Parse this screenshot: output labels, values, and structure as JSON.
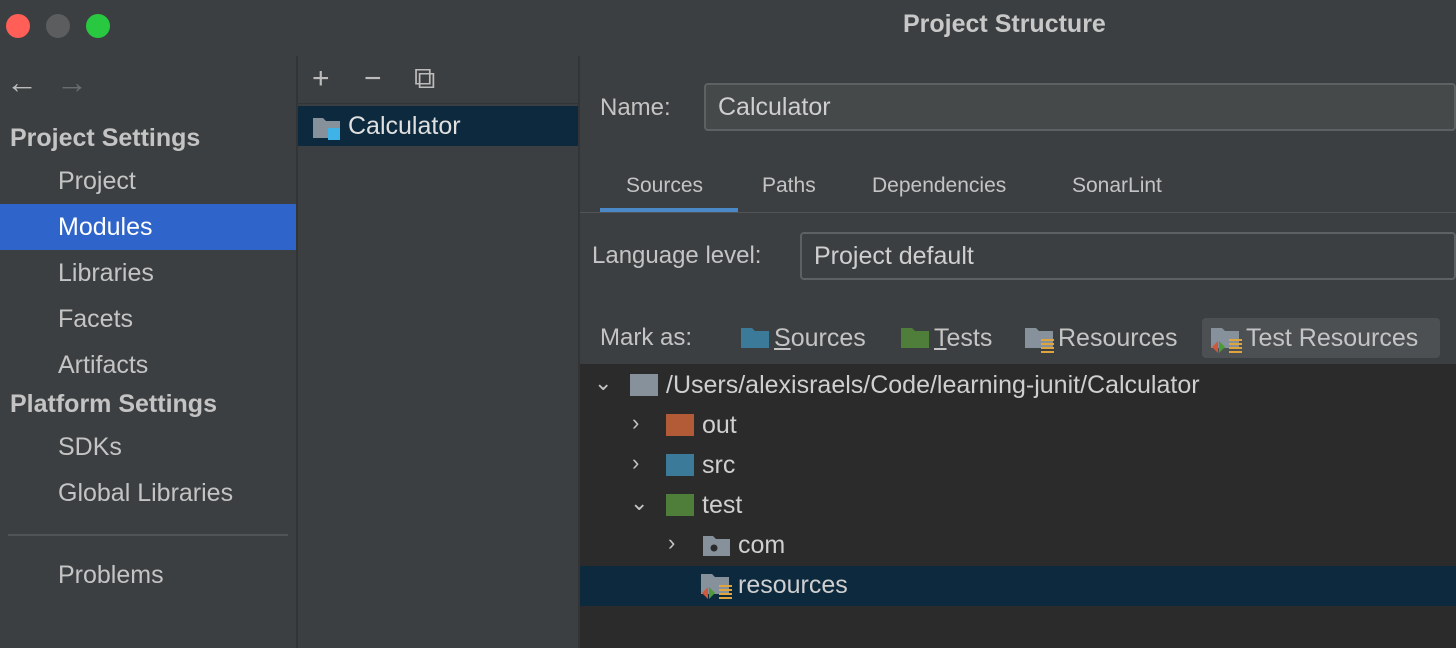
{
  "window": {
    "title": "Project Structure"
  },
  "nav": {
    "back": "←",
    "forward": "→"
  },
  "sidebar": {
    "project_settings_header": "Project Settings",
    "items": [
      "Project",
      "Modules",
      "Libraries",
      "Facets",
      "Artifacts"
    ],
    "platform_settings_header": "Platform Settings",
    "platform_items": [
      "SDKs",
      "Global Libraries"
    ],
    "problems": "Problems",
    "selected": "Modules"
  },
  "modules_panel": {
    "toolbar": {
      "add": "+",
      "remove": "−",
      "copy": "⧉"
    },
    "module_name": "Calculator"
  },
  "detail": {
    "name_label": "Name:",
    "name_value": "Calculator",
    "tabs": [
      "Sources",
      "Paths",
      "Dependencies",
      "SonarLint"
    ],
    "active_tab": "Sources",
    "language_level_label": "Language level:",
    "language_level_value": "Project default",
    "mark_as_label": "Mark as:",
    "mark_buttons": [
      {
        "underlined": "S",
        "rest": "ources",
        "color": "#3c7a99"
      },
      {
        "underlined": "T",
        "rest": "ests",
        "color": "#4e7e3a"
      },
      {
        "label": "Resources",
        "color": "#87919c"
      },
      {
        "label": "Test Resources",
        "color": "#87919c"
      }
    ],
    "tree": [
      {
        "label": "/Users/alexisraels/Code/learning-junit/Calculator",
        "expanded": true,
        "color": "#87919c"
      },
      {
        "label": "out",
        "expanded": false,
        "color": "#b25b36"
      },
      {
        "label": "src",
        "expanded": false,
        "color": "#3c7a99"
      },
      {
        "label": "test",
        "expanded": true,
        "color": "#4e7e3a"
      },
      {
        "label": "com",
        "expanded": false,
        "color": "#87919c"
      },
      {
        "label": "resources",
        "selected": true,
        "color": "#87919c"
      }
    ],
    "chevron_collapsed": "›",
    "chevron_expanded": "⌄"
  }
}
